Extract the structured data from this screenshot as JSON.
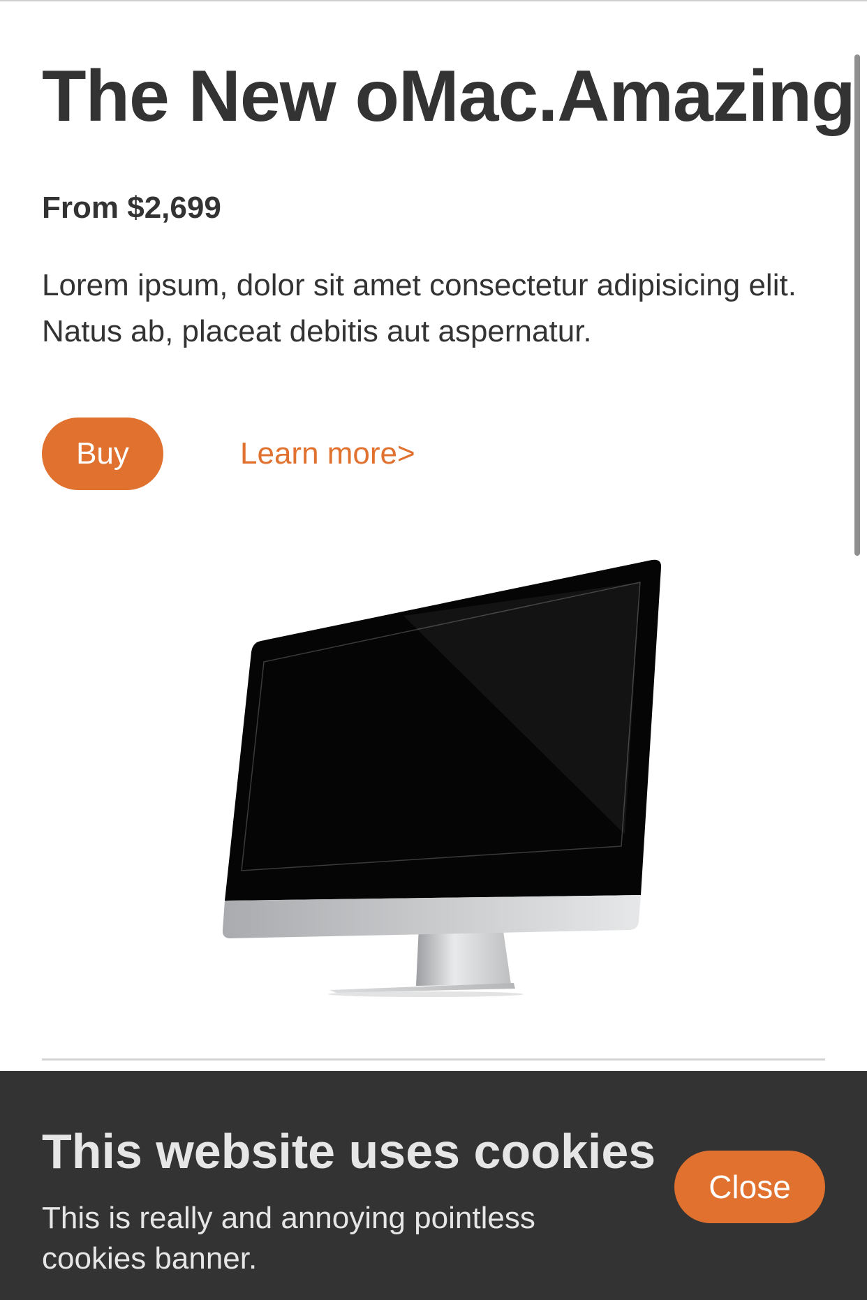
{
  "hero": {
    "title": "The New oMac.Amazing",
    "price": "From $2,699",
    "description": "Lorem ipsum, dolor sit amet consectetur adipisicing elit. Natus ab, placeat debitis aut aspernatur.",
    "buy_label": "Buy",
    "learn_more_label": "Learn more>",
    "product_image": "desktop-monitor"
  },
  "cookie_banner": {
    "title": "This website uses cookies",
    "text": "This is really and annoying pointless cookies banner.",
    "close_label": "Close"
  },
  "colors": {
    "accent": "#e0712e",
    "text": "#333333",
    "banner_background": "#333333",
    "banner_text": "#e6e6e6"
  }
}
